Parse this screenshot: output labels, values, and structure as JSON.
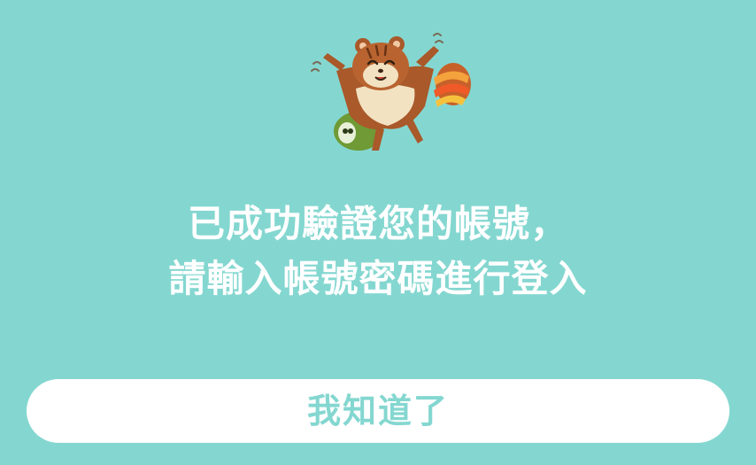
{
  "dialog": {
    "message_line1": "已成功驗證您的帳號，",
    "message_line2": "請輸入帳號密碼進行登入",
    "confirm_label": "我知道了"
  },
  "mascot": {
    "icon": "flying-squirrel-mascot"
  },
  "colors": {
    "background": "#84d7d0",
    "button_bg": "#ffffff",
    "button_text": "#84d7d0",
    "message_text": "#ffffff"
  }
}
